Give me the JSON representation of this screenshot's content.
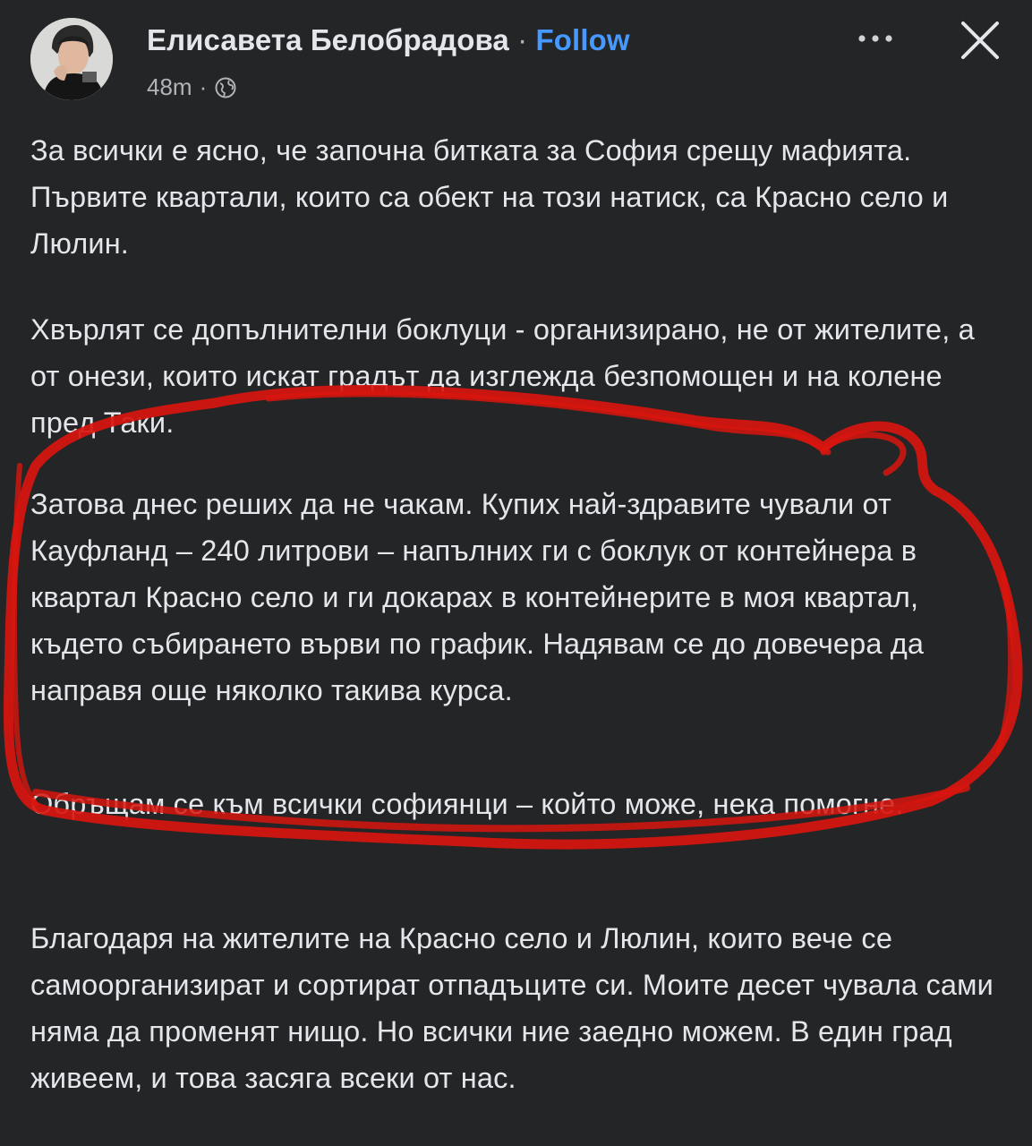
{
  "post": {
    "author": "Елисавета Белобрадова",
    "separator": "·",
    "follow_label": "Follow",
    "timestamp": "48m",
    "meta_separator": "·",
    "privacy_icon": "globe-icon",
    "more_icon": "more-options-icon",
    "close_icon": "close-icon",
    "paragraphs": [
      "За всички е ясно, че започна битката за София срещу мафията. Първите квартали, които са обект на този натиск, са Красно село и Люлин.",
      "Хвърлят се допълнителни боклуци - организирано, не от жителите, а от онези, които искат градът да изглежда безпомощен и на колене пред Таки.",
      "Затова днес реших да не чакам. Купих най-здравите чували от Кауфланд – 240 литрови – напълних ги с боклук от контейнера в квартал Красно село и ги докарах в контейнерите в моя квартал, където събирането върви по график. Надявам се до довечера да направя още няколко такива курса.",
      "Обръщам се към всички софиянци – който може, нека помогне.",
      "Благодаря на жителите на Красно село и Люлин, които вече се самоорганизират и сортират отпадъците си. Моите десет чувала сами няма да променят нищо. Но всички ние заедно  можем. В един град живеем, и това засяга всеки от нас."
    ]
  },
  "colors": {
    "background": "#242526",
    "text": "#e4e6eb",
    "secondary_text": "#b0b3b8",
    "follow_link": "#4599ff",
    "markup_stroke": "#d8150e"
  }
}
